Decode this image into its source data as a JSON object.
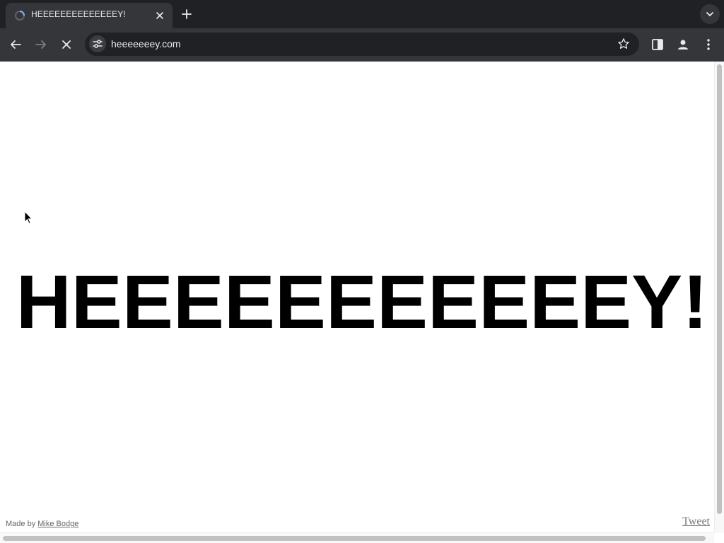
{
  "tab": {
    "title": "HEEEEEEEEEEEEEEY!",
    "favicon": "loading-spinner-icon",
    "close_icon": "close-icon"
  },
  "tabstrip": {
    "new_tab_icon": "plus-icon",
    "tab_search_icon": "chevron-down-icon"
  },
  "toolbar": {
    "back_icon": "arrow-left-icon",
    "forward_icon": "arrow-right-icon",
    "stop_icon": "close-icon",
    "site_info_icon": "tune-icon",
    "url": "heeeeeeey.com",
    "bookmark_icon": "star-outline-icon",
    "side_panel_icon": "side-panel-icon",
    "profile_icon": "person-icon",
    "menu_icon": "kebab-menu-icon"
  },
  "page": {
    "heading": "HEEEEEEEEEEEY!",
    "credit_prefix": "Made by",
    "credit_link": "Mike Bodge",
    "tweet": "Tweet"
  },
  "colors": {
    "tabstrip_bg": "#202124",
    "toolbar_bg": "#35363a",
    "omnibox_bg": "#202124",
    "heading": "#000000",
    "page_bg": "#ffffff"
  }
}
